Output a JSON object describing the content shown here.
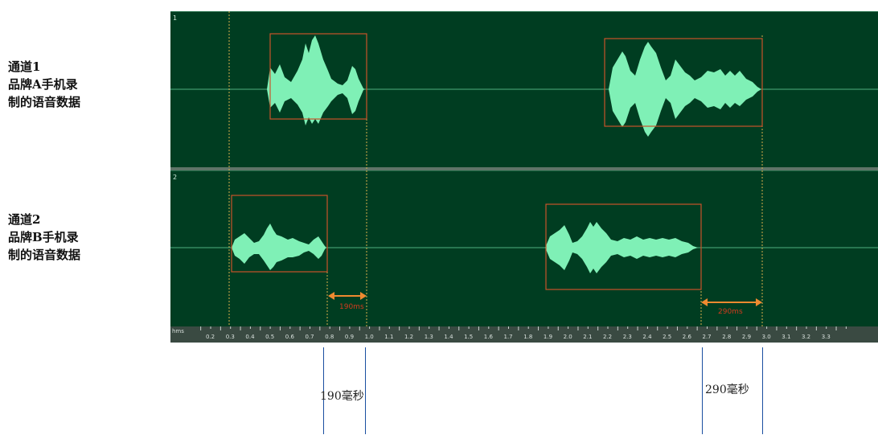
{
  "labels": {
    "ch1_title": "通道1",
    "ch1_line2": "品牌A手机录",
    "ch1_line3": "制的语音数据",
    "ch2_title": "通道2",
    "ch2_line2": "品牌B手机录",
    "ch2_line3": "制的语音数据"
  },
  "tracks": {
    "track1_number": "1",
    "track2_number": "2"
  },
  "gaps": {
    "gap1_inner_label": "190ms",
    "gap2_inner_label": "290ms",
    "gap1_caption": "190毫秒",
    "gap2_caption": "290毫秒",
    "gap1_value_ms": 190,
    "gap2_value_ms": 290
  },
  "ruler": {
    "unit_label": "hms",
    "ticks": [
      "0.2",
      "0.3",
      "0.4",
      "0.5",
      "0.6",
      "0.7",
      "0.8",
      "0.9",
      "1.0",
      "1.1",
      "1.2",
      "1.3",
      "1.4",
      "1.5",
      "1.6",
      "1.7",
      "1.8",
      "1.9",
      "2.0",
      "2.1",
      "2.2",
      "2.3",
      "2.4",
      "2.5",
      "2.6",
      "2.7",
      "2.8",
      "2.9",
      "3.0",
      "3.1",
      "3.2",
      "3.3"
    ]
  },
  "colors": {
    "track_bg": "#003d21",
    "waveform": "#7ff0b6",
    "box": "#c8542a",
    "arrow": "#f08a30",
    "marker_line": "#1a4fa0"
  }
}
